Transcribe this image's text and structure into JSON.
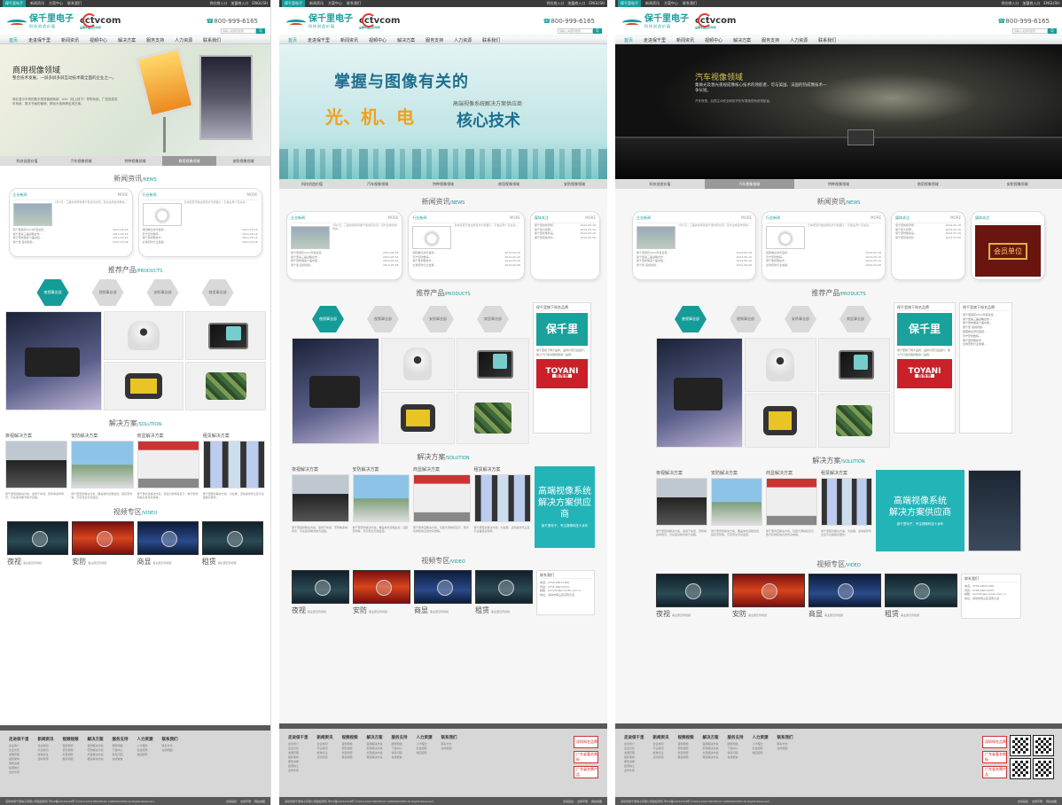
{
  "topbar": {
    "links": [
      "保千里电子",
      "新闻资讯",
      "方案中心",
      "联系我们"
    ],
    "right": [
      "供应商入口",
      "加盟商入口",
      "ENGLISH"
    ]
  },
  "header": {
    "logo_main": "保千里电子",
    "logo_sub": "科技创造价值",
    "partner_logo": "cctvcom",
    "partner_sub": "品牌中国合作伙伴",
    "phone": "800-999-6165",
    "search_placeholder": "请输入关键字搜索",
    "search_button": "Q"
  },
  "nav": [
    "首页",
    "走进保千里",
    "新闻资讯",
    "视频中心",
    "解决方案",
    "服务支持",
    "人力资源",
    "联系我们"
  ],
  "banner": {
    "p1_title": "商用视像领域",
    "p1_desc": "整合技术发展，一屏多屏多屏互动技术最全面的企业之一。",
    "p1_desc2": "商业显示市场的数字视觉营销系统、o2o（线上线下）导购系统、广告信息发布系统、数字书画的营销、移动大电商等应用方案。",
    "p2_line1": "掌握与图像有关的",
    "p2_line2": "光、机、电",
    "p2_line3": "核心技术",
    "p2_sub": "高端视像系统解决方案供应商",
    "p3_title": "汽车视像领域",
    "p3_desc": "集微光及激光夜视成像核心技术的领航者，可与美国、法国的热成像技术一争长短。",
    "p3_desc2": "汽车夜视、后视主动安全和防护的车载夜视系统领航者。"
  },
  "tabs": [
    "科技创造价值",
    "汽车视像领域",
    "特种视像领域",
    "商用视像领域",
    "安防视像领域"
  ],
  "news": {
    "title": "新闻资讯",
    "title_en": "/NEWS",
    "boxes": [
      {
        "label": "企业新闻",
        "more": "MORE",
        "summary": "7月1日，三星的领导到保千里访问交流，双方达成合作意向...",
        "rows": [
          [
            "保千里荣获2014年度最佳…",
            "2014-05-18"
          ],
          [
            "保千里第三届战略合作…",
            "2014-05-16"
          ],
          [
            "保千里参展第十届中国…",
            "2014-05-16"
          ],
          [
            "保千里 夜视视频…",
            "2014-05-08"
          ]
        ]
      },
      {
        "label": "行业新闻",
        "more": "MORE",
        "summary": "日本索尼开发出两足步行机器人，引发业界广泛关注...",
        "rows": [
          [
            "韩国推出激光夜视…",
            "2014-05-18"
          ],
          [
            "苏宁安防数码…",
            "2014-05-16"
          ],
          [
            "保千里视像技术…",
            "2014-05-16"
          ],
          [
            "全球安防行业发展…",
            "2014-05-08"
          ]
        ]
      },
      {
        "label": "媒体关注",
        "more": "MORE",
        "summary": "",
        "rows": [
          [
            "保千里的新梦想…",
            "2014-05-18"
          ],
          [
            "保千里大视野…",
            "2014-05-16"
          ],
          [
            "保千里视像新品…",
            "2014-05-16"
          ],
          [
            "保千里营收增长…",
            "2014-05-08"
          ]
        ]
      }
    ],
    "award_caption": "会员单位"
  },
  "products": {
    "title": "推荐产品",
    "title_en": "/PRODUCTS",
    "tabs": [
      "夜视事业部",
      "视频事业部",
      "安防事业部",
      "商显事业部"
    ],
    "brand_panel_title": "保千里旗下知名品牌",
    "brand1": "保千里",
    "brand2": "TOYANI",
    "brand2_sub": "图雅丽",
    "brand_desc": "保千里旗下两大品牌，品牌价值日益提升，致力于打造中国视像第一品牌。"
  },
  "solutions": {
    "title": "解决方案",
    "title_en": "/SOLUTION",
    "cards": [
      {
        "title": "夜视解决方案",
        "desc": "保千里夜视解决方案，适用于车载、安防等多种场景，可在夜间看清前方道路。"
      },
      {
        "title": "安防解决方案",
        "desc": "保千里安防解决方案，覆盖城市道路监控、园区安防等，可实现全天候监控。"
      },
      {
        "title": "商显解决方案",
        "desc": "保千里商显解决方案，包括大屏拼接显示、数字标牌和信息发布系统等。"
      },
      {
        "title": "租赁解决方案",
        "desc": "保千里租赁解决方案，为会展、活动提供专业显示设备租赁服务。"
      }
    ],
    "promo_line1": "高端视像系统",
    "promo_line2": "解决方案供应商",
    "promo_sub": "保千里电子，专注视像科技十余年"
  },
  "video": {
    "title": "视频专区",
    "title_en": "/VIDEO",
    "items": [
      {
        "name": "夜视",
        "sub": "事业部宣传视频"
      },
      {
        "name": "安防",
        "sub": "事业部宣传视频"
      },
      {
        "name": "商显",
        "sub": "事业部宣传视频"
      },
      {
        "name": "租赁",
        "sub": "事业部宣传视频"
      }
    ],
    "contact_title": "联系我们",
    "contact_lines": [
      "电话：0755-26071166",
      "传真：0755-26071533",
      "邮箱：pcmoth@pcmoth.com.cn",
      "地址：深圳市南山区深南大道"
    ]
  },
  "footer": {
    "cols": [
      {
        "title": "走进保千里",
        "items": [
          "企业简介",
          "企业文化",
          "发展历程",
          "组织架构",
          "荣誉资质",
          "招贤纳士",
          "合作伙伴"
        ]
      },
      {
        "title": "新闻资讯",
        "items": [
          "企业新闻",
          "行业新闻",
          "媒体关注",
          "活动专题"
        ]
      },
      {
        "title": "视频视频",
        "items": [
          "夜视视频",
          "安防视频",
          "商显视频",
          "租赁视频"
        ]
      },
      {
        "title": "解决方案",
        "items": [
          "夜视解决方案",
          "安防解决方案",
          "商显解决方案",
          "租赁解决方案"
        ]
      },
      {
        "title": "服务支持",
        "items": [
          "服务网络",
          "下载中心",
          "常见问题",
          "在线留言"
        ]
      },
      {
        "title": "人力资源",
        "items": [
          "人才理念",
          "社会招聘",
          "校园招聘"
        ]
      },
      {
        "title": "联系我们",
        "items": [
          "联系方式",
          "在线地图"
        ]
      }
    ],
    "badges": [
      "深圳知名品牌",
      "广东省著名商标",
      "广东省名牌产品"
    ],
    "copyright": "深圳市保千里电子有限公司版权所有  粤ICP备12042244号  ©2010-2013 PROTRULY CORPORATION All Rights Reserved.",
    "bottom_links": [
      "友情链接",
      "法律声明",
      "网站地图"
    ]
  }
}
